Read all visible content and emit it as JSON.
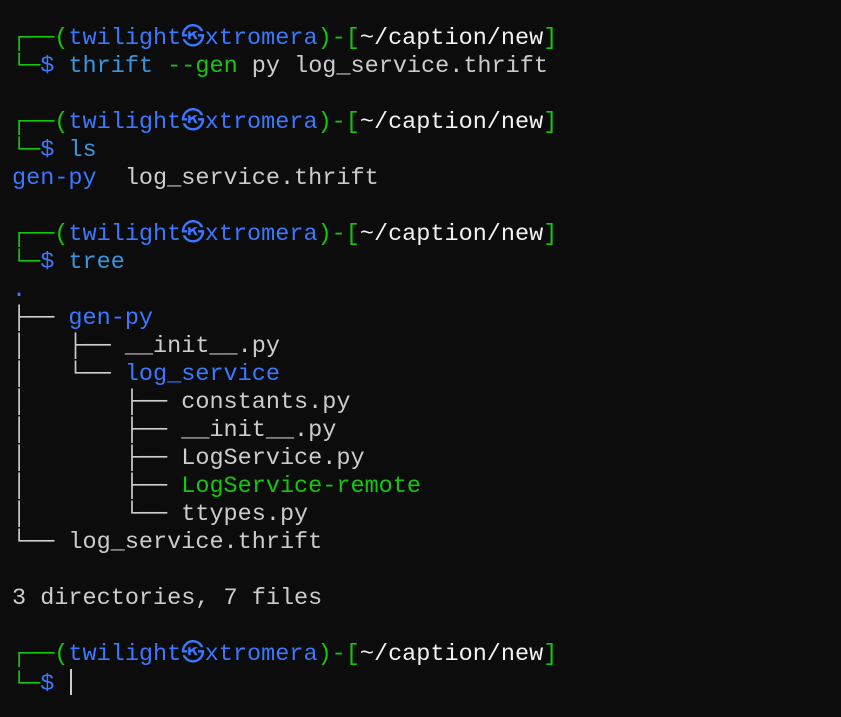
{
  "colors": {
    "green": "#16c60c",
    "blue": "#3b78ff",
    "cyan": "#3a96dd",
    "white": "#cccccc",
    "bright": "#f2f2f2"
  },
  "lines": [
    {
      "kind": "prompt-top",
      "segs": [
        [
          "┌──(",
          "green"
        ],
        [
          "twilight㉿xtromera",
          "blue"
        ],
        [
          ")-[",
          "green"
        ],
        [
          "~/caption/new",
          "bright"
        ],
        [
          "]",
          "green"
        ]
      ]
    },
    {
      "kind": "prompt-cmd",
      "segs": [
        [
          "└─",
          "green"
        ],
        [
          "$ ",
          "blue"
        ],
        [
          "thrift",
          "cyan"
        ],
        [
          " --gen",
          "green"
        ],
        [
          " py log_service.thrift",
          "white"
        ]
      ]
    },
    {
      "kind": "blank",
      "segs": []
    },
    {
      "kind": "prompt-top",
      "segs": [
        [
          "┌──(",
          "green"
        ],
        [
          "twilight㉿xtromera",
          "blue"
        ],
        [
          ")-[",
          "green"
        ],
        [
          "~/caption/new",
          "bright"
        ],
        [
          "]",
          "green"
        ]
      ]
    },
    {
      "kind": "prompt-cmd",
      "segs": [
        [
          "└─",
          "green"
        ],
        [
          "$ ",
          "blue"
        ],
        [
          "ls",
          "cyan"
        ]
      ]
    },
    {
      "kind": "output",
      "segs": [
        [
          "gen-py",
          "blue"
        ],
        [
          "  log_service.thrift",
          "white"
        ]
      ]
    },
    {
      "kind": "blank",
      "segs": []
    },
    {
      "kind": "prompt-top",
      "segs": [
        [
          "┌──(",
          "green"
        ],
        [
          "twilight㉿xtromera",
          "blue"
        ],
        [
          ")-[",
          "green"
        ],
        [
          "~/caption/new",
          "bright"
        ],
        [
          "]",
          "green"
        ]
      ]
    },
    {
      "kind": "prompt-cmd",
      "segs": [
        [
          "└─",
          "green"
        ],
        [
          "$ ",
          "blue"
        ],
        [
          "tree",
          "cyan"
        ]
      ]
    },
    {
      "kind": "output",
      "segs": [
        [
          ".",
          "blue"
        ]
      ]
    },
    {
      "kind": "output",
      "segs": [
        [
          "├── ",
          "white"
        ],
        [
          "gen-py",
          "blue"
        ]
      ]
    },
    {
      "kind": "output",
      "segs": [
        [
          "│   ├── ",
          "white"
        ],
        [
          "__init__.py",
          "white"
        ]
      ]
    },
    {
      "kind": "output",
      "segs": [
        [
          "│   └── ",
          "white"
        ],
        [
          "log_service",
          "blue"
        ]
      ]
    },
    {
      "kind": "output",
      "segs": [
        [
          "│       ├── ",
          "white"
        ],
        [
          "constants.py",
          "white"
        ]
      ]
    },
    {
      "kind": "output",
      "segs": [
        [
          "│       ├── ",
          "white"
        ],
        [
          "__init__.py",
          "white"
        ]
      ]
    },
    {
      "kind": "output",
      "segs": [
        [
          "│       ├── ",
          "white"
        ],
        [
          "LogService.py",
          "white"
        ]
      ]
    },
    {
      "kind": "output",
      "segs": [
        [
          "│       ├── ",
          "white"
        ],
        [
          "LogService-remote",
          "green"
        ]
      ]
    },
    {
      "kind": "output",
      "segs": [
        [
          "│       └── ",
          "white"
        ],
        [
          "ttypes.py",
          "white"
        ]
      ]
    },
    {
      "kind": "output",
      "segs": [
        [
          "└── ",
          "white"
        ],
        [
          "log_service.thrift",
          "white"
        ]
      ]
    },
    {
      "kind": "blank",
      "segs": []
    },
    {
      "kind": "output",
      "segs": [
        [
          "3 directories, 7 files",
          "white"
        ]
      ]
    },
    {
      "kind": "blank",
      "segs": []
    },
    {
      "kind": "prompt-top",
      "segs": [
        [
          "┌──(",
          "green"
        ],
        [
          "twilight㉿xtromera",
          "blue"
        ],
        [
          ")-[",
          "green"
        ],
        [
          "~/caption/new",
          "bright"
        ],
        [
          "]",
          "green"
        ]
      ]
    },
    {
      "kind": "prompt-active",
      "segs": [
        [
          "└─",
          "green"
        ],
        [
          "$ ",
          "blue"
        ]
      ]
    }
  ]
}
